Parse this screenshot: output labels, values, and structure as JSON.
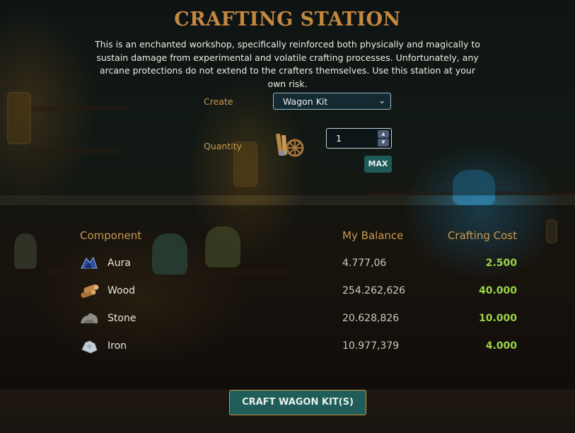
{
  "header": {
    "title": "CRAFTING STATION",
    "description": "This is an enchanted workshop, specifically reinforced both physically and magically to sustain damage from experimental and volatile crafting processes. Unfortunately, any arcane protections do not extend to the crafters themselves. Use this station at your own risk."
  },
  "form": {
    "create_label": "Create",
    "create_value": "Wagon Kit",
    "quantity_label": "Quantity",
    "quantity_value": "1",
    "max_label": "MAX",
    "item_icon": "wagon-kit-icon"
  },
  "table": {
    "headers": {
      "component": "Component",
      "balance": "My Balance",
      "cost": "Crafting Cost"
    },
    "rows": [
      {
        "name": "Aura",
        "balance": "4.777,06",
        "cost": "2.500",
        "icon": "aura-icon"
      },
      {
        "name": "Wood",
        "balance": "254.262,626",
        "cost": "40.000",
        "icon": "wood-icon"
      },
      {
        "name": "Stone",
        "balance": "20.628,826",
        "cost": "10.000",
        "icon": "stone-icon"
      },
      {
        "name": "Iron",
        "balance": "10.977,379",
        "cost": "4.000",
        "icon": "iron-icon"
      }
    ]
  },
  "actions": {
    "craft_label": "CRAFT WAGON KIT(S)"
  },
  "colors": {
    "title": "#c4883f",
    "label": "#c9994d",
    "cost": "#9bd34a",
    "button": "#1f5c5a"
  }
}
